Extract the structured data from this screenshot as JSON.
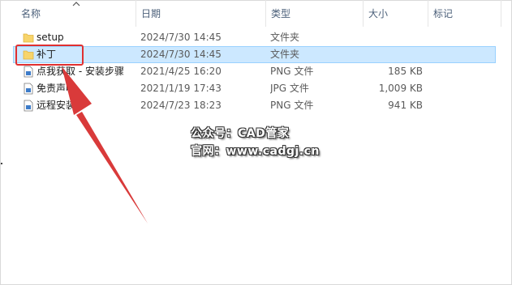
{
  "columns": {
    "name": "名称",
    "date": "日期",
    "type": "类型",
    "size": "大小",
    "tags": "标记"
  },
  "files": [
    {
      "name": "setup",
      "date": "2024/7/30 14:45",
      "type": "文件夹",
      "size": "",
      "icon": "folder-icon",
      "selected": false
    },
    {
      "name": "补丁",
      "date": "2024/7/30 14:45",
      "type": "文件夹",
      "size": "",
      "icon": "folder-icon",
      "selected": true
    },
    {
      "name": "点我获取 - 安装步骤",
      "date": "2021/4/25 16:20",
      "type": "PNG 文件",
      "size": "185 KB",
      "icon": "image-file-icon",
      "selected": false
    },
    {
      "name": "免责声明",
      "date": "2021/1/19 17:43",
      "type": "JPG 文件",
      "size": "1,009 KB",
      "icon": "image-file-icon",
      "selected": false
    },
    {
      "name": "远程安装",
      "date": "2024/7/23 18:23",
      "type": "PNG 文件",
      "size": "941 KB",
      "icon": "image-file-icon",
      "selected": false
    }
  ],
  "watermark": {
    "line1": "公众号：CAD管家",
    "line2": "官网：www.cadgj.cn"
  },
  "colors": {
    "selection": "#cce8ff",
    "annotation": "#e03030",
    "folder": "#f7d46b"
  }
}
